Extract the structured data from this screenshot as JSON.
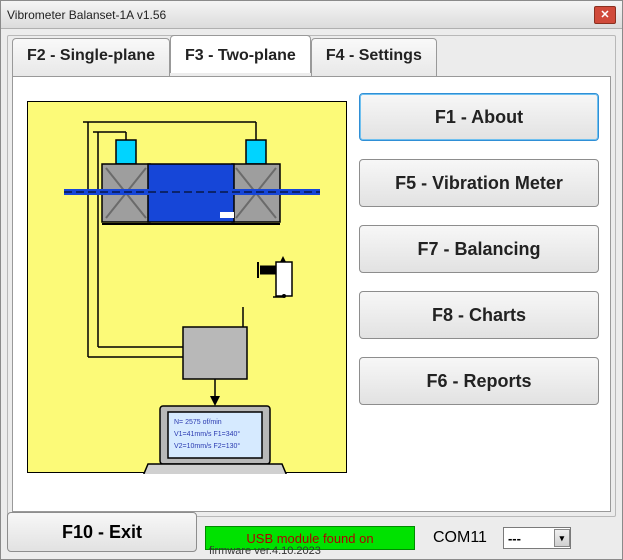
{
  "window": {
    "title": "Vibrometer Balanset-1A  v1.56"
  },
  "tabs": {
    "single": "F2 - Single-plane",
    "two": "F3 - Two-plane",
    "settings": "F4 - Settings"
  },
  "buttons": {
    "about": "F1 - About",
    "vibmeter": "F5 - Vibration Meter",
    "balancing": "F7 - Balancing",
    "charts": "F8 - Charts",
    "reports": "F6 - Reports",
    "exit": "F10 - Exit"
  },
  "status": {
    "usb": "USB module found on",
    "port": "COM11",
    "combo_value": "---"
  },
  "firmware": "firmware ver.4.10.2023",
  "laptop_screen": {
    "l1": "N=  2575 of/min",
    "l2": "V1=41mm/s   F1=340°",
    "l3": "V2=10mm/s   F2=130°"
  }
}
